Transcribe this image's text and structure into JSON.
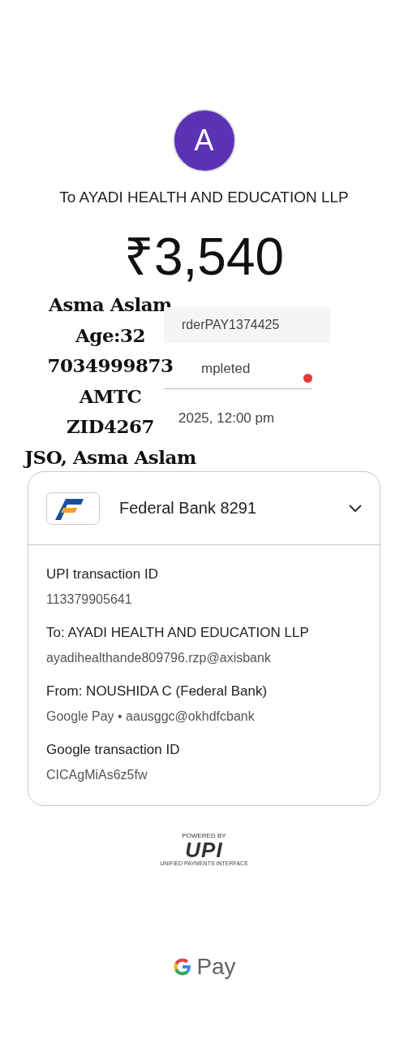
{
  "recipient": {
    "avatar_letter": "A",
    "title": "To AYADI HEALTH AND EDUCATION LLP"
  },
  "amount": "₹3,540",
  "overlay_note": [
    "Asma Aslam",
    "Age:32",
    "7034999873",
    "AMTC",
    "ZID4267",
    "JSO, Asma Aslam"
  ],
  "partial_rows": [
    {
      "kind": "note",
      "text": "rderPAY1374425"
    },
    {
      "kind": "status",
      "text": "mpleted"
    },
    {
      "kind": "date",
      "text": "2025, 12:00 pm"
    }
  ],
  "account": {
    "bank": "Federal Bank 8291"
  },
  "details": [
    {
      "label": "UPI transaction ID",
      "value": "113379905641"
    },
    {
      "label": "To: AYADI HEALTH AND EDUCATION LLP",
      "value": "ayadihealthande809796.rzp@axisbank"
    },
    {
      "label": "From: NOUSHIDA C (Federal Bank)",
      "value": "Google Pay • aausggc@okhdfcbank"
    },
    {
      "label": "Google transaction ID",
      "value": "CICAgMiAs6z5fw"
    }
  ],
  "footer": {
    "powered_by": "POWERED BY",
    "upi": "UPI",
    "upi_tagline": "UNIFIED PAYMENTS INTERFACE",
    "brand": "Pay"
  }
}
